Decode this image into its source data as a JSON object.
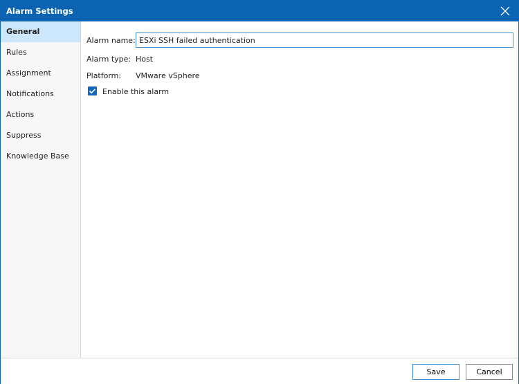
{
  "window": {
    "title": "Alarm Settings"
  },
  "sidebar": {
    "items": [
      {
        "label": "General",
        "active": true
      },
      {
        "label": "Rules"
      },
      {
        "label": "Assignment"
      },
      {
        "label": "Notifications"
      },
      {
        "label": "Actions"
      },
      {
        "label": "Suppress"
      },
      {
        "label": "Knowledge Base"
      }
    ]
  },
  "general": {
    "name_label": "Alarm name:",
    "name_value": "ESXi SSH failed authentication",
    "type_label": "Alarm type:",
    "type_value": "Host",
    "platform_label": "Platform:",
    "platform_value": "VMware vSphere",
    "enable_label": "Enable this alarm",
    "enable_checked": true
  },
  "footer": {
    "save": "Save",
    "cancel": "Cancel"
  },
  "colors": {
    "accent": "#0b63b1",
    "selected": "#cce6fb"
  }
}
